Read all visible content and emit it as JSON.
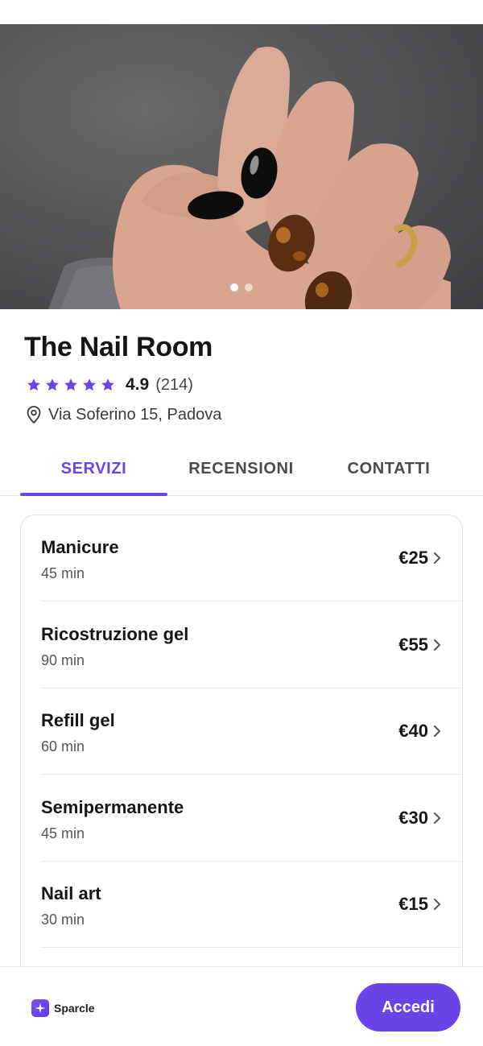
{
  "shop": {
    "name": "The Nail Room",
    "rating": "4.9",
    "review_count": "(214)",
    "stars": 5,
    "address": "Via Soferino 15, Padova"
  },
  "gallery": {
    "slides": 2,
    "active_slide": 1
  },
  "tabs": [
    {
      "label": "SERVIZI",
      "active": true
    },
    {
      "label": "RECENSIONI",
      "active": false
    },
    {
      "label": "CONTATTI",
      "active": false
    }
  ],
  "services": [
    {
      "name": "Manicure",
      "duration": "45 min",
      "price": "€25"
    },
    {
      "name": "Ricostruzione gel",
      "duration": "90 min",
      "price": "€55"
    },
    {
      "name": "Refill gel",
      "duration": "60 min",
      "price": "€40"
    },
    {
      "name": "Semipermanente",
      "duration": "45 min",
      "price": "€30"
    },
    {
      "name": "Nail art",
      "duration": "30 min",
      "price": "€15"
    }
  ],
  "footer": {
    "brand": "Sparcle",
    "cta_label": "Accedi"
  },
  "colors": {
    "accent": "#6a44e8",
    "star": "#6a44e8"
  },
  "icons": {
    "star": "star-icon",
    "location": "map-pin-icon",
    "chevron": "chevron-right-icon",
    "brand": "sparkle-icon"
  }
}
